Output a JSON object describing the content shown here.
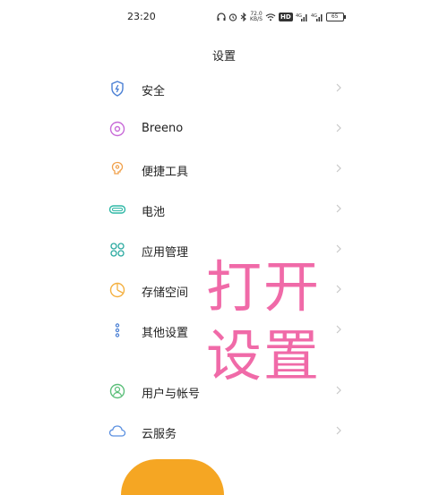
{
  "status_bar": {
    "time": "23:20",
    "network_speed_value": "72.0",
    "network_speed_unit": "KB/S",
    "hd_label": "HD",
    "battery_level": "65"
  },
  "header": {
    "title": "设置"
  },
  "settings": {
    "items": [
      {
        "label": "安全",
        "icon": "shield-icon"
      },
      {
        "label": "Breeno",
        "icon": "breeno-icon"
      },
      {
        "label": "便捷工具",
        "icon": "shortcut-tools-icon"
      },
      {
        "label": "电池",
        "icon": "battery-icon"
      },
      {
        "label": "应用管理",
        "icon": "app-management-icon"
      },
      {
        "label": "存储空间",
        "icon": "storage-icon"
      },
      {
        "label": "其他设置",
        "icon": "more-settings-icon"
      },
      {
        "label": "用户与帐号",
        "icon": "user-account-icon"
      },
      {
        "label": "云服务",
        "icon": "cloud-icon"
      }
    ]
  },
  "overlay": {
    "line1": "打开",
    "line2": "设置"
  },
  "colors": {
    "overlay_pink": "#f06aa8",
    "shield_blue": "#4a7fd4",
    "breeno_purple": "#c86ad8",
    "tools_orange": "#f0a04a",
    "battery_teal": "#2fb8a6",
    "apps_teal": "#2aa9a0",
    "storage_orange": "#f4b040",
    "user_green": "#5cbf7a",
    "cloud_blue": "#5a8fe0",
    "chevron_gray": "#c8c8c8"
  }
}
